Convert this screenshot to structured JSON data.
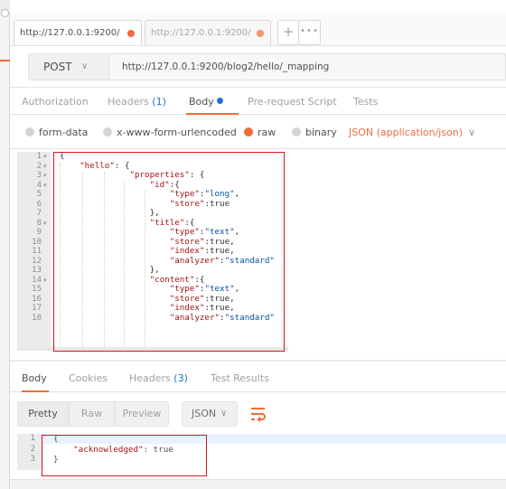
{
  "tabs": [
    {
      "label": "http://127.0.0.1:9200/"
    },
    {
      "label": "http://127.0.0.1:9200/"
    }
  ],
  "tab_controls": {
    "add": "+",
    "more": "•••"
  },
  "request": {
    "method": "POST",
    "url": "http://127.0.0.1:9200/blog2/hello/_mapping"
  },
  "request_tabs": {
    "authorization": "Authorization",
    "headers": "Headers",
    "headers_count": "(1)",
    "body": "Body",
    "pre_request": "Pre-request Script",
    "tests": "Tests"
  },
  "body_options": {
    "form_data": "form-data",
    "urlencoded": "x-www-form-urlencoded",
    "raw": "raw",
    "binary": "binary",
    "content_type": "JSON (application/json)",
    "selected": "raw"
  },
  "editor": {
    "line_numbers": [
      "1",
      "2",
      "3",
      "4",
      "5",
      "6",
      "7",
      "8",
      "9",
      "10",
      "11",
      "12",
      "13",
      "14",
      "15",
      "16",
      "17",
      "18"
    ],
    "lines": [
      "{",
      "    \"hello\": {",
      "              \"properties\": {",
      "                  \"id\":{",
      "                      \"type\":\"long\",",
      "                      \"store\":true",
      "                  },",
      "                  \"title\":{",
      "                      \"type\":\"text\",",
      "                      \"store\":true,",
      "                      \"index\":true,",
      "                      \"analyzer\":\"standard\"",
      "                  },",
      "                  \"content\":{",
      "                      \"type\":\"text\",",
      "                      \"store\":true,",
      "                      \"index\":true,",
      "                      \"analyzer\":\"standard\""
    ]
  },
  "response_tabs": {
    "body": "Body",
    "cookies": "Cookies",
    "headers": "Headers",
    "headers_count": "(3)",
    "test_results": "Test Results"
  },
  "view_modes": {
    "pretty": "Pretty",
    "raw": "Raw",
    "preview": "Preview",
    "format": "JSON"
  },
  "response": {
    "line_numbers": [
      "1",
      "2",
      "3"
    ],
    "lines": [
      "{",
      "    \"acknowledged\": true",
      "}"
    ]
  },
  "colors": {
    "accent": "#f26b3a",
    "link_blue": "#1e72c9",
    "highlight_box": "#e0141e"
  }
}
